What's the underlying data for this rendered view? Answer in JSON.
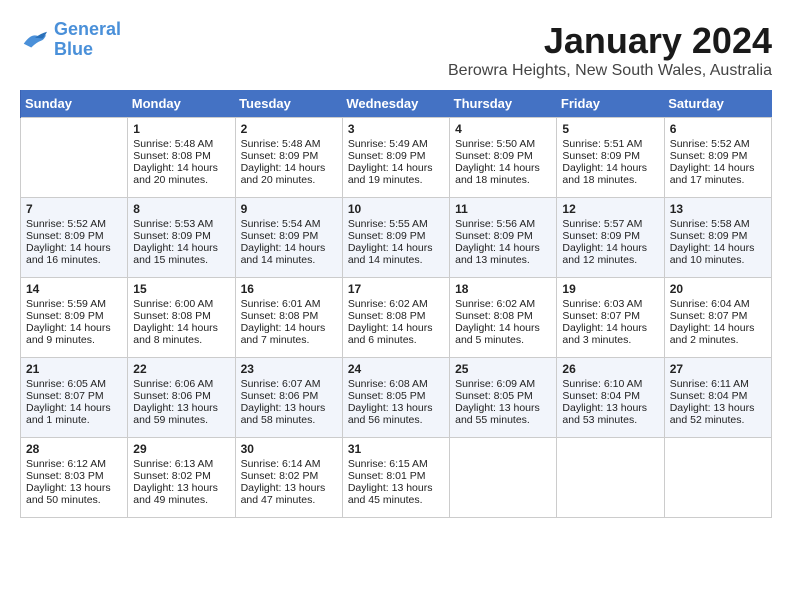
{
  "header": {
    "logo_line1": "General",
    "logo_line2": "Blue",
    "month_title": "January 2024",
    "location": "Berowra Heights, New South Wales, Australia"
  },
  "days_of_week": [
    "Sunday",
    "Monday",
    "Tuesday",
    "Wednesday",
    "Thursday",
    "Friday",
    "Saturday"
  ],
  "weeks": [
    [
      {
        "day": "",
        "sunrise": "",
        "sunset": "",
        "daylight": ""
      },
      {
        "day": "1",
        "sunrise": "Sunrise: 5:48 AM",
        "sunset": "Sunset: 8:08 PM",
        "daylight": "Daylight: 14 hours and 20 minutes."
      },
      {
        "day": "2",
        "sunrise": "Sunrise: 5:48 AM",
        "sunset": "Sunset: 8:09 PM",
        "daylight": "Daylight: 14 hours and 20 minutes."
      },
      {
        "day": "3",
        "sunrise": "Sunrise: 5:49 AM",
        "sunset": "Sunset: 8:09 PM",
        "daylight": "Daylight: 14 hours and 19 minutes."
      },
      {
        "day": "4",
        "sunrise": "Sunrise: 5:50 AM",
        "sunset": "Sunset: 8:09 PM",
        "daylight": "Daylight: 14 hours and 18 minutes."
      },
      {
        "day": "5",
        "sunrise": "Sunrise: 5:51 AM",
        "sunset": "Sunset: 8:09 PM",
        "daylight": "Daylight: 14 hours and 18 minutes."
      },
      {
        "day": "6",
        "sunrise": "Sunrise: 5:52 AM",
        "sunset": "Sunset: 8:09 PM",
        "daylight": "Daylight: 14 hours and 17 minutes."
      }
    ],
    [
      {
        "day": "7",
        "sunrise": "Sunrise: 5:52 AM",
        "sunset": "Sunset: 8:09 PM",
        "daylight": "Daylight: 14 hours and 16 minutes."
      },
      {
        "day": "8",
        "sunrise": "Sunrise: 5:53 AM",
        "sunset": "Sunset: 8:09 PM",
        "daylight": "Daylight: 14 hours and 15 minutes."
      },
      {
        "day": "9",
        "sunrise": "Sunrise: 5:54 AM",
        "sunset": "Sunset: 8:09 PM",
        "daylight": "Daylight: 14 hours and 14 minutes."
      },
      {
        "day": "10",
        "sunrise": "Sunrise: 5:55 AM",
        "sunset": "Sunset: 8:09 PM",
        "daylight": "Daylight: 14 hours and 14 minutes."
      },
      {
        "day": "11",
        "sunrise": "Sunrise: 5:56 AM",
        "sunset": "Sunset: 8:09 PM",
        "daylight": "Daylight: 14 hours and 13 minutes."
      },
      {
        "day": "12",
        "sunrise": "Sunrise: 5:57 AM",
        "sunset": "Sunset: 8:09 PM",
        "daylight": "Daylight: 14 hours and 12 minutes."
      },
      {
        "day": "13",
        "sunrise": "Sunrise: 5:58 AM",
        "sunset": "Sunset: 8:09 PM",
        "daylight": "Daylight: 14 hours and 10 minutes."
      }
    ],
    [
      {
        "day": "14",
        "sunrise": "Sunrise: 5:59 AM",
        "sunset": "Sunset: 8:09 PM",
        "daylight": "Daylight: 14 hours and 9 minutes."
      },
      {
        "day": "15",
        "sunrise": "Sunrise: 6:00 AM",
        "sunset": "Sunset: 8:08 PM",
        "daylight": "Daylight: 14 hours and 8 minutes."
      },
      {
        "day": "16",
        "sunrise": "Sunrise: 6:01 AM",
        "sunset": "Sunset: 8:08 PM",
        "daylight": "Daylight: 14 hours and 7 minutes."
      },
      {
        "day": "17",
        "sunrise": "Sunrise: 6:02 AM",
        "sunset": "Sunset: 8:08 PM",
        "daylight": "Daylight: 14 hours and 6 minutes."
      },
      {
        "day": "18",
        "sunrise": "Sunrise: 6:02 AM",
        "sunset": "Sunset: 8:08 PM",
        "daylight": "Daylight: 14 hours and 5 minutes."
      },
      {
        "day": "19",
        "sunrise": "Sunrise: 6:03 AM",
        "sunset": "Sunset: 8:07 PM",
        "daylight": "Daylight: 14 hours and 3 minutes."
      },
      {
        "day": "20",
        "sunrise": "Sunrise: 6:04 AM",
        "sunset": "Sunset: 8:07 PM",
        "daylight": "Daylight: 14 hours and 2 minutes."
      }
    ],
    [
      {
        "day": "21",
        "sunrise": "Sunrise: 6:05 AM",
        "sunset": "Sunset: 8:07 PM",
        "daylight": "Daylight: 14 hours and 1 minute."
      },
      {
        "day": "22",
        "sunrise": "Sunrise: 6:06 AM",
        "sunset": "Sunset: 8:06 PM",
        "daylight": "Daylight: 13 hours and 59 minutes."
      },
      {
        "day": "23",
        "sunrise": "Sunrise: 6:07 AM",
        "sunset": "Sunset: 8:06 PM",
        "daylight": "Daylight: 13 hours and 58 minutes."
      },
      {
        "day": "24",
        "sunrise": "Sunrise: 6:08 AM",
        "sunset": "Sunset: 8:05 PM",
        "daylight": "Daylight: 13 hours and 56 minutes."
      },
      {
        "day": "25",
        "sunrise": "Sunrise: 6:09 AM",
        "sunset": "Sunset: 8:05 PM",
        "daylight": "Daylight: 13 hours and 55 minutes."
      },
      {
        "day": "26",
        "sunrise": "Sunrise: 6:10 AM",
        "sunset": "Sunset: 8:04 PM",
        "daylight": "Daylight: 13 hours and 53 minutes."
      },
      {
        "day": "27",
        "sunrise": "Sunrise: 6:11 AM",
        "sunset": "Sunset: 8:04 PM",
        "daylight": "Daylight: 13 hours and 52 minutes."
      }
    ],
    [
      {
        "day": "28",
        "sunrise": "Sunrise: 6:12 AM",
        "sunset": "Sunset: 8:03 PM",
        "daylight": "Daylight: 13 hours and 50 minutes."
      },
      {
        "day": "29",
        "sunrise": "Sunrise: 6:13 AM",
        "sunset": "Sunset: 8:02 PM",
        "daylight": "Daylight: 13 hours and 49 minutes."
      },
      {
        "day": "30",
        "sunrise": "Sunrise: 6:14 AM",
        "sunset": "Sunset: 8:02 PM",
        "daylight": "Daylight: 13 hours and 47 minutes."
      },
      {
        "day": "31",
        "sunrise": "Sunrise: 6:15 AM",
        "sunset": "Sunset: 8:01 PM",
        "daylight": "Daylight: 13 hours and 45 minutes."
      },
      {
        "day": "",
        "sunrise": "",
        "sunset": "",
        "daylight": ""
      },
      {
        "day": "",
        "sunrise": "",
        "sunset": "",
        "daylight": ""
      },
      {
        "day": "",
        "sunrise": "",
        "sunset": "",
        "daylight": ""
      }
    ]
  ]
}
